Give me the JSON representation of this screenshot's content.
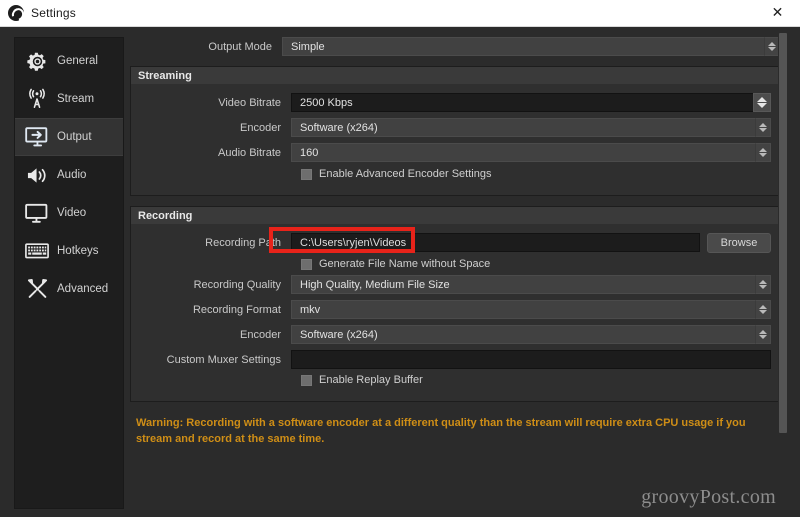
{
  "window": {
    "title": "Settings",
    "app_icon": "obs-logo-icon",
    "close_label": "✕"
  },
  "sidebar": {
    "items": [
      {
        "label": "General",
        "icon": "gear-icon",
        "selected": false
      },
      {
        "label": "Stream",
        "icon": "antenna-icon",
        "selected": false
      },
      {
        "label": "Output",
        "icon": "monitor-arrow-icon",
        "selected": true
      },
      {
        "label": "Audio",
        "icon": "speaker-icon",
        "selected": false
      },
      {
        "label": "Video",
        "icon": "display-icon",
        "selected": false
      },
      {
        "label": "Hotkeys",
        "icon": "keyboard-icon",
        "selected": false
      },
      {
        "label": "Advanced",
        "icon": "tools-icon",
        "selected": false
      }
    ]
  },
  "content": {
    "output_mode": {
      "label": "Output Mode",
      "value": "Simple"
    },
    "streaming": {
      "title": "Streaming",
      "video_bitrate": {
        "label": "Video Bitrate",
        "value": "2500 Kbps"
      },
      "encoder": {
        "label": "Encoder",
        "value": "Software (x264)"
      },
      "audio_bitrate": {
        "label": "Audio Bitrate",
        "value": "160"
      },
      "advanced_checkbox": {
        "label": "Enable Advanced Encoder Settings",
        "checked": false
      }
    },
    "recording": {
      "title": "Recording",
      "recording_path": {
        "label": "Recording Path",
        "value": "C:\\Users\\ryjen\\Videos",
        "browse_label": "Browse"
      },
      "generate_name_checkbox": {
        "label": "Generate File Name without Space",
        "checked": false
      },
      "recording_quality": {
        "label": "Recording Quality",
        "value": "High Quality, Medium File Size"
      },
      "recording_format": {
        "label": "Recording Format",
        "value": "mkv"
      },
      "encoder": {
        "label": "Encoder",
        "value": "Software (x264)"
      },
      "custom_muxer": {
        "label": "Custom Muxer Settings",
        "value": ""
      },
      "replay_buffer_checkbox": {
        "label": "Enable Replay Buffer",
        "checked": false
      }
    },
    "warning": "Warning: Recording with a software encoder at a different quality than the stream will require extra CPU usage if you stream and record at the same time."
  },
  "watermark": "groovyPost.com",
  "colors": {
    "accent_warning": "#cf8e16",
    "annotation_red": "#e8231a",
    "panel_bg": "#2f2f2f",
    "window_bg": "#2b2b2b",
    "sidebar_bg": "#1e1e1e"
  }
}
